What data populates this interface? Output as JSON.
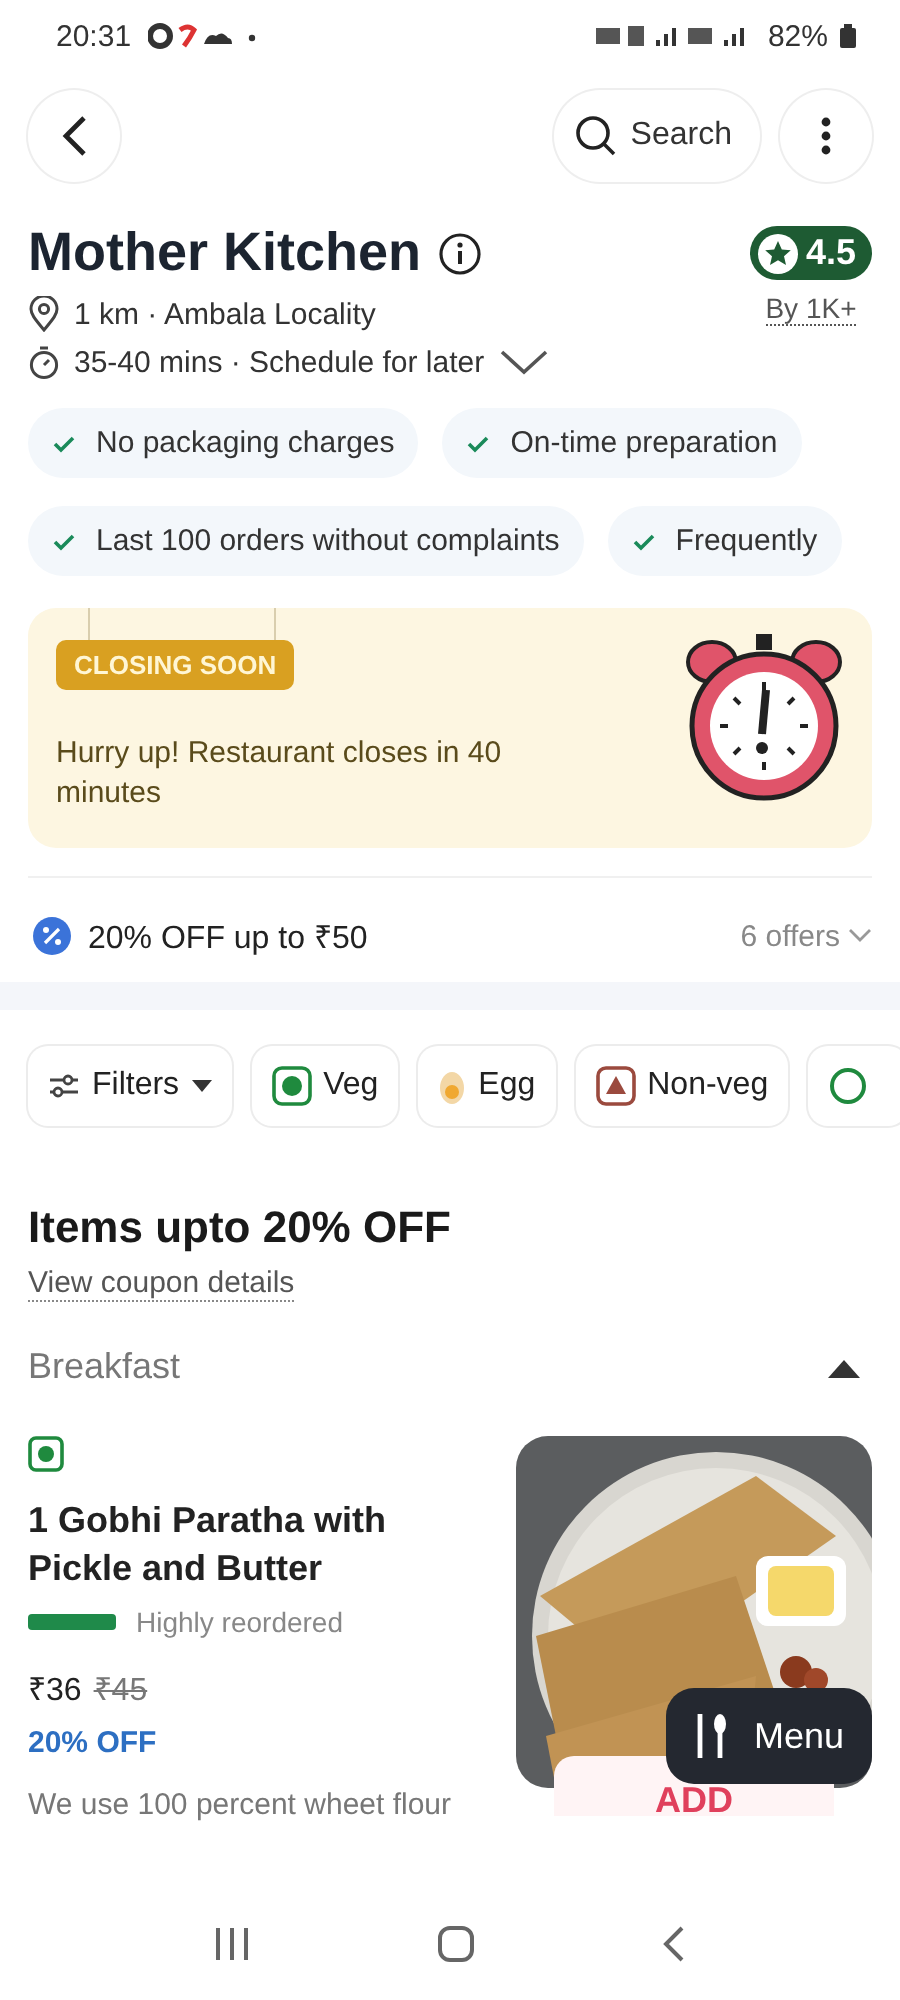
{
  "status_bar": {
    "time": "20:31",
    "battery": "82%"
  },
  "header": {
    "search_label": "Search"
  },
  "restaurant": {
    "name": "Mother Kitchen",
    "rating": "4.5",
    "rating_count": "By 1K+",
    "distance": "1 km · Ambala Locality",
    "delivery": "35-40 mins · Schedule for later"
  },
  "features": [
    [
      "No packaging charges",
      "On-time preparation"
    ],
    [
      "Last 100 orders without complaints",
      "Frequently"
    ]
  ],
  "closing_banner": {
    "badge": "CLOSING SOON",
    "message": "Hurry up! Restaurant closes in 40 minutes"
  },
  "offer": {
    "text": "20% OFF up to ₹50",
    "count": "6 offers"
  },
  "filters": [
    {
      "kind": "filters",
      "label": "Filters"
    },
    {
      "kind": "veg",
      "label": "Veg"
    },
    {
      "kind": "egg",
      "label": "Egg"
    },
    {
      "kind": "nonveg",
      "label": "Non-veg"
    },
    {
      "kind": "partial"
    }
  ],
  "section": {
    "title": "Items upto 20% OFF",
    "link": "View coupon details"
  },
  "category": {
    "name": "Breakfast",
    "expanded": true
  },
  "item": {
    "veg": true,
    "name": "1 Gobhi Paratha with Pickle and Butter",
    "tag": "Highly reordered",
    "price": "₹36",
    "old_price": "₹45",
    "discount": "20% OFF",
    "description": "We use 100 percent wheet flour",
    "add_label": "ADD"
  },
  "menu_button": {
    "label": "Menu"
  }
}
